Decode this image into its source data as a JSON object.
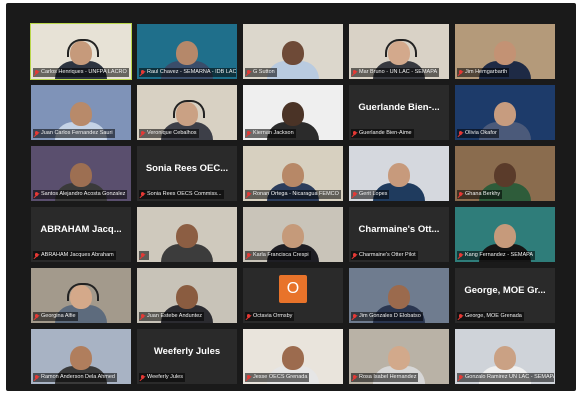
{
  "meeting": {
    "participants": [
      {
        "label": "Carlos Henriques - UNFPA LACRO",
        "type": "video",
        "bg": "#e7e2d6",
        "skin": "#c69a7b",
        "shirt": "#2d3440",
        "active": true,
        "headset": true
      },
      {
        "label": "Raul Chavez - SEMARNA - IDB LAC",
        "type": "video",
        "bg": "#1f6f8b",
        "skin": "#b5886a",
        "shirt": "#3a4d6a",
        "active": false,
        "headset": false
      },
      {
        "label": "G Sutton",
        "type": "video",
        "bg": "#dcd7cc",
        "skin": "#6e4a37",
        "shirt": "#b9cbe0",
        "active": false,
        "headset": false
      },
      {
        "label": "Mar Bruno - UN LAC - SEMAPA",
        "type": "video",
        "bg": "#d9d2c6",
        "skin": "#d3a98c",
        "shirt": "#37393f",
        "active": false,
        "headset": true
      },
      {
        "label": "Jim Hemgarbarth",
        "type": "video",
        "bg": "#b49a7a",
        "skin": "#c39274",
        "shirt": "#1e2a45",
        "active": false,
        "headset": false
      },
      {
        "label": "Juan Carlos Fernandez Sauri",
        "type": "video",
        "bg": "#7f93b8",
        "skin": "#b88a6a",
        "shirt": "#c5d3e6",
        "active": false,
        "headset": false
      },
      {
        "label": "Veronique Cebalhos",
        "type": "video",
        "bg": "#d8d1c3",
        "skin": "#caa184",
        "shirt": "#3d3f48",
        "active": false,
        "headset": true
      },
      {
        "label": "Kiernan Jackson",
        "type": "video",
        "bg": "#efefef",
        "skin": "#4a3326",
        "shirt": "#2b2b2b",
        "active": false,
        "headset": false
      },
      {
        "label": "Guerlande Bien-Aime",
        "type": "text",
        "name": "Guerlande Bien-...",
        "active": false
      },
      {
        "label": "Olivia Okafor",
        "type": "video",
        "bg": "#1d3b6a",
        "skin": "#c79c7f",
        "shirt": "#4b5a7a",
        "active": false,
        "headset": false
      },
      {
        "label": "Santos Alejandro Acosta Gonzalez",
        "type": "video",
        "bg": "#5a4f6e",
        "skin": "#9d6f52",
        "shirt": "#3a3a3a",
        "active": false,
        "headset": false
      },
      {
        "label": "Sonia Rees OECS Commiss...",
        "type": "text",
        "name": "Sonia Rees OEC...",
        "active": false
      },
      {
        "label": "Ronan Ortega - Nicaragua FEMCO",
        "type": "video",
        "bg": "#d7d0c0",
        "skin": "#b78867",
        "shirt": "#2c3d5c",
        "active": false,
        "headset": false
      },
      {
        "label": "Gerit Lopes",
        "type": "video",
        "bg": "#d5d8de",
        "skin": "#c79a7c",
        "shirt": "#1f3b5e",
        "active": false,
        "headset": false
      },
      {
        "label": "Ghana Berkhy",
        "type": "video",
        "bg": "#8a6c4e",
        "skin": "#5a3b2a",
        "shirt": "#2e5c3a",
        "active": false,
        "headset": false
      },
      {
        "label": "ABRAHAM Jacques Abraham",
        "type": "text",
        "name": "ABRAHAM Jacq...",
        "active": false
      },
      {
        "label": "",
        "type": "video",
        "bg": "#cfc9bd",
        "skin": "#8c5e43",
        "shirt": "#3c3c3c",
        "active": false,
        "headset": false
      },
      {
        "label": "Karla Francisca Crespi",
        "type": "video",
        "bg": "#c9c4b9",
        "skin": "#c59a7a",
        "shirt": "#1e1e24",
        "active": false,
        "headset": false
      },
      {
        "label": "Charmaine's Otter Pilot",
        "type": "text",
        "name": "Charmaine's Ott...",
        "active": false
      },
      {
        "label": "Kang Fernandez - SEMAPA",
        "type": "video",
        "bg": "#2f7d7a",
        "skin": "#c69a7b",
        "shirt": "#161616",
        "active": false,
        "headset": false
      },
      {
        "label": "Georgina Alfie",
        "type": "video",
        "bg": "#a39a8c",
        "skin": "#d4a98a",
        "shirt": "#5d6b7d",
        "active": false,
        "headset": true
      },
      {
        "label": "Juan Estebe Anduntez",
        "type": "video",
        "bg": "#c8c3b8",
        "skin": "#8a5c40",
        "shirt": "#2b2b30",
        "active": false,
        "headset": false
      },
      {
        "label": "Octavia Ormsby",
        "type": "avatar",
        "initial": "O",
        "active": false
      },
      {
        "label": "Jim Gonzales D Elobatso",
        "type": "video",
        "bg": "#6f7c8f",
        "skin": "#9b6a4d",
        "shirt": "#2a3650",
        "active": false,
        "headset": false
      },
      {
        "label": "George, MOE Grenada",
        "type": "text",
        "name": "George, MOE Gr...",
        "active": false
      },
      {
        "label": "Ramon Anderson Dela Ahmed",
        "type": "video",
        "bg": "#a8b3c4",
        "skin": "#b07e5d",
        "shirt": "#3a3a3a",
        "active": false,
        "headset": false
      },
      {
        "label": "Weeferly Jules",
        "type": "text",
        "name": "Weeferly Jules",
        "active": false
      },
      {
        "label": "Jesse OECS Grenada",
        "type": "video",
        "bg": "#e9e4dc",
        "skin": "#9c6b4e",
        "shirt": "#e6e6e6",
        "active": false,
        "headset": false
      },
      {
        "label": "Rosa Isabel Hernandez",
        "type": "video",
        "bg": "#b9b2a6",
        "skin": "#d2a98b",
        "shirt": "#d7d7d7",
        "active": false,
        "headset": false
      },
      {
        "label": "Gonzalo Ramirez UN LAC - SEMAPA",
        "type": "video",
        "bg": "#cfd3d9",
        "skin": "#caa184",
        "shirt": "#f0f0f0",
        "active": false,
        "headset": false
      }
    ]
  }
}
